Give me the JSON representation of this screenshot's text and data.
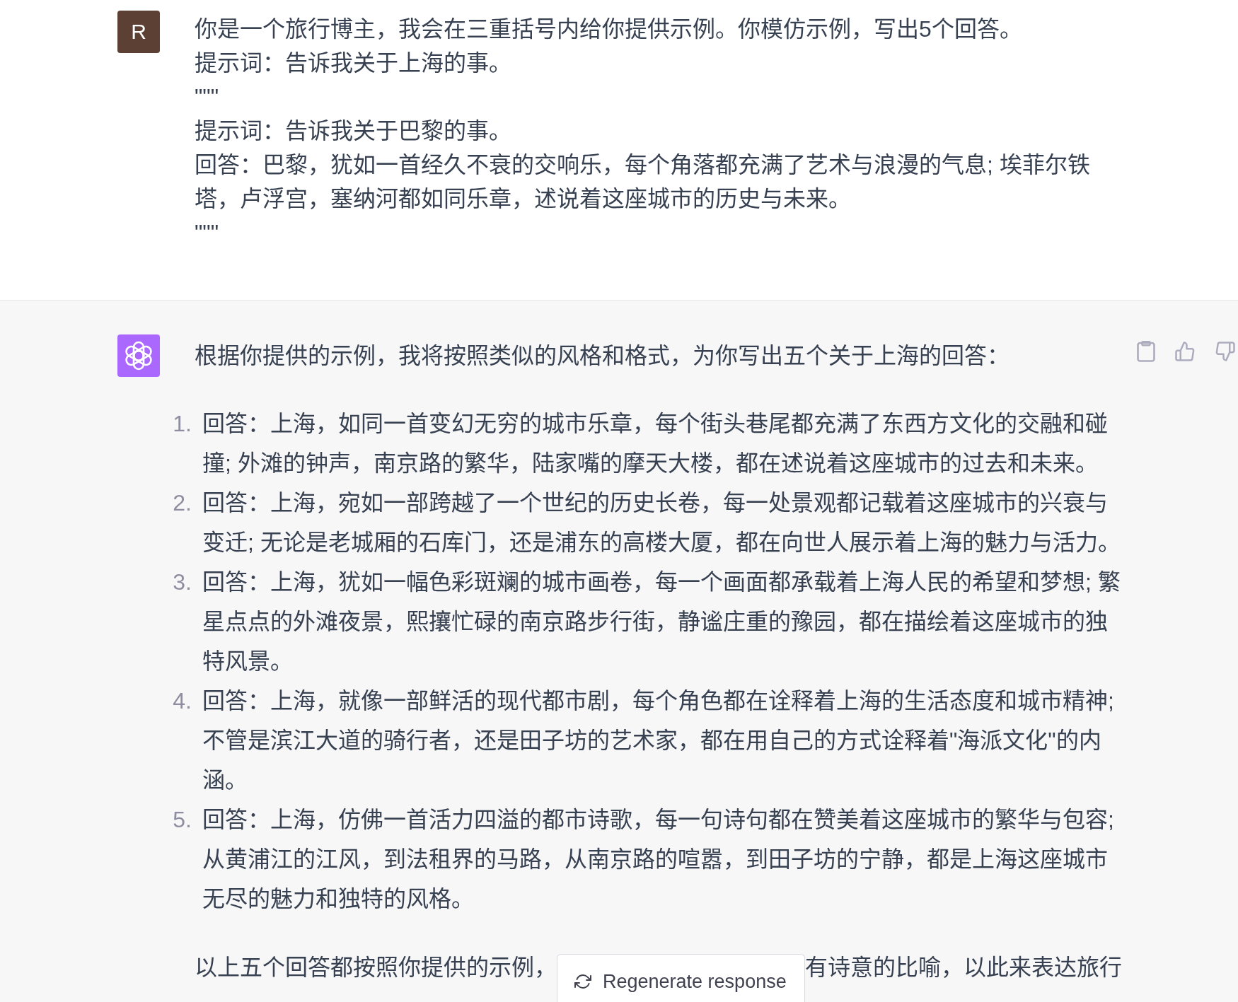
{
  "conversation": [
    {
      "kind": "user",
      "avatar_letter": "R",
      "lines": [
        "你是一个旅行博主，我会在三重括号内给你提供示例。你模仿示例，写出5个回答。",
        "提示词：告诉我关于上海的事。",
        "\"\"\"",
        "提示词：告诉我关于巴黎的事。",
        "回答：巴黎，犹如一首经久不衰的交响乐，每个角落都充满了艺术与浪漫的气息; 埃菲尔铁塔，卢浮宫，塞纳河都如同乐章，述说着这座城市的历史与未来。",
        "\"\"\""
      ]
    },
    {
      "kind": "assistant",
      "intro": "根据你提供的示例，我将按照类似的风格和格式，为你写出五个关于上海的回答：",
      "answers": [
        {
          "number": "1.",
          "text": "回答：上海，如同一首变幻无穷的城市乐章，每个街头巷尾都充满了东西方文化的交融和碰撞; 外滩的钟声，南京路的繁华，陆家嘴的摩天大楼，都在述说着这座城市的过去和未来。"
        },
        {
          "number": "2.",
          "text": "回答：上海，宛如一部跨越了一个世纪的历史长卷，每一处景观都记载着这座城市的兴衰与变迁; 无论是老城厢的石库门，还是浦东的高楼大厦，都在向世人展示着上海的魅力与活力。"
        },
        {
          "number": "3.",
          "text": "回答：上海，犹如一幅色彩斑斓的城市画卷，每一个画面都承载着上海人民的希望和梦想; 繁星点点的外滩夜景，熙攘忙碌的南京路步行街，静谧庄重的豫园，都在描绘着这座城市的独特风景。"
        },
        {
          "number": "4.",
          "text": "回答：上海，就像一部鲜活的现代都市剧，每个角色都在诠释着上海的生活态度和城市精神; 不管是滨江大道的骑行者，还是田子坊的艺术家，都在用自己的方式诠释着\"海派文化\"的内涵。"
        },
        {
          "number": "5.",
          "text": "回答：上海，仿佛一首活力四溢的都市诗歌，每一句诗句都在赞美着这座城市的繁华与包容; 从黄浦江的江风，到法租界的马路，从南京路的喧嚣，到田子坊的宁静，都是上海这座城市无尽的魅力和独特的风格。"
        }
      ],
      "closing": [
        "以上五个回答都按照你提供的示例，",
        "有诗意的比喻，以此来表达旅行"
      ]
    }
  ],
  "regenerate_button": {
    "label": "Regenerate response"
  }
}
